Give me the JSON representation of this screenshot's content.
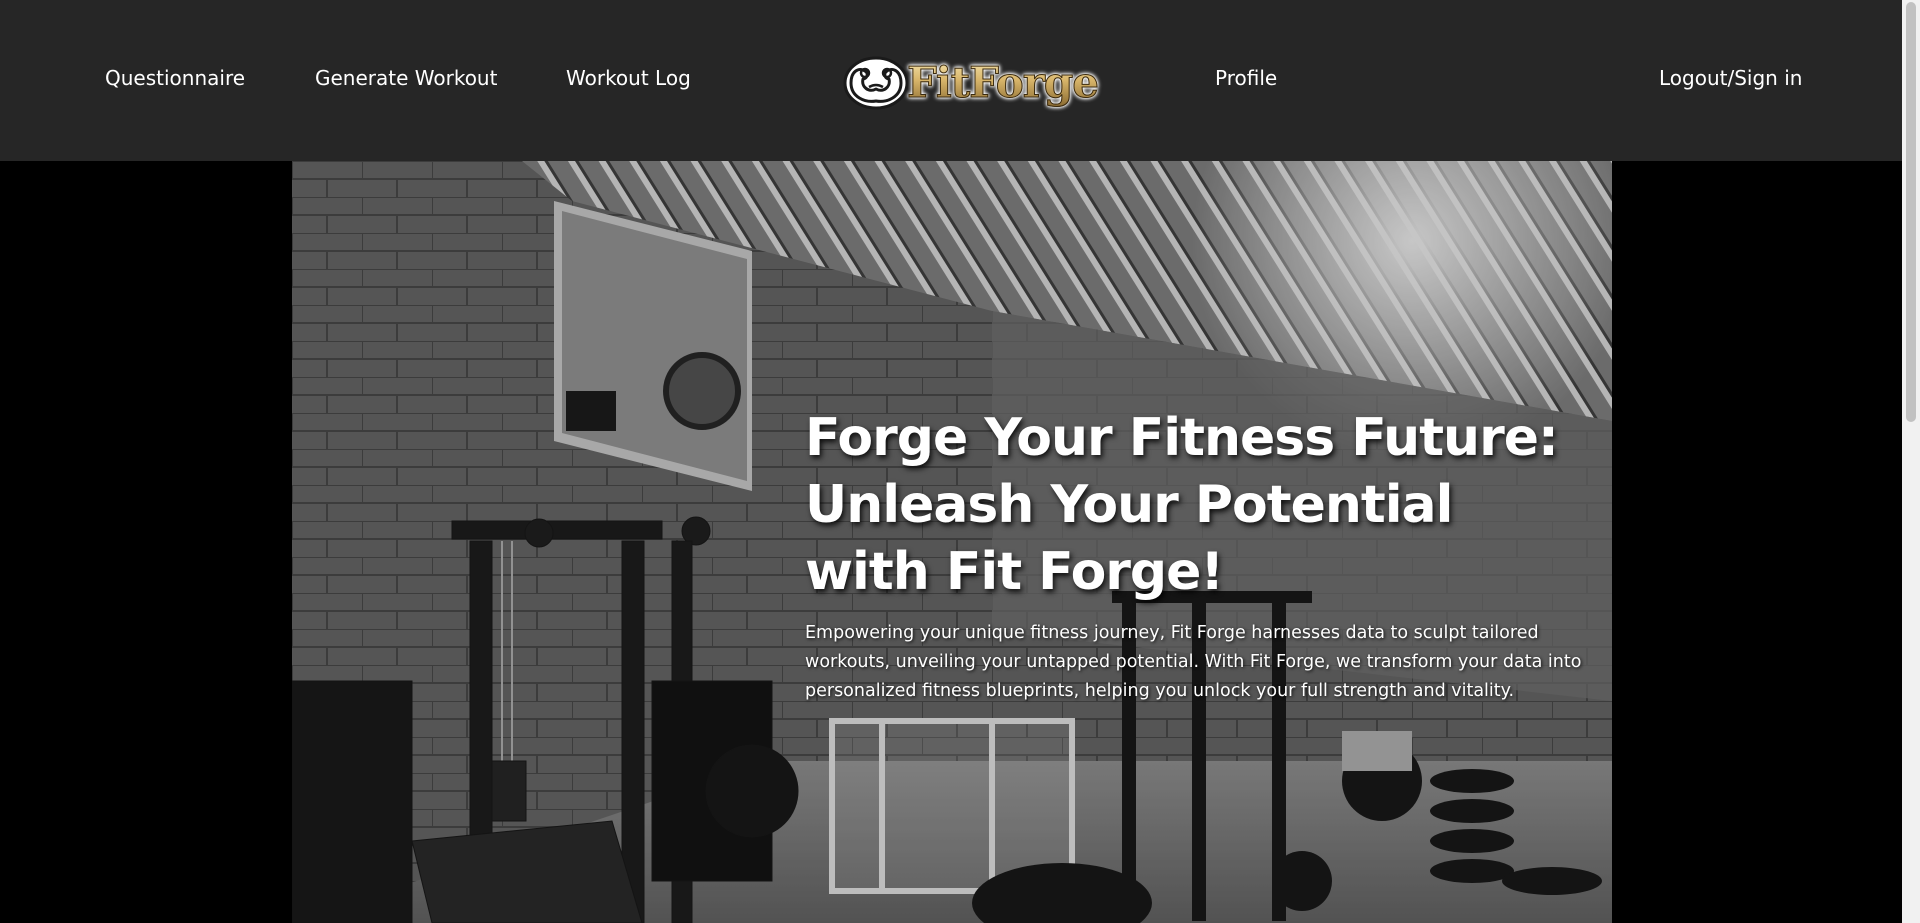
{
  "nav": {
    "questionnaire": "Questionnaire",
    "generate_workout": "Generate Workout",
    "workout_log": "Workout Log",
    "profile": "Profile",
    "logout_signin": "Logout/Sign in"
  },
  "logo": {
    "text": "FitForge",
    "icon": "flexing-arms-icon"
  },
  "hero": {
    "title": "Forge Your Fitness Future: Unleash Your Potential with Fit Forge!",
    "description": "Empowering your unique fitness journey, Fit Forge harnesses data to sculpt tailored workouts, unveiling your untapped potential. With Fit Forge, we transform your data into personalized fitness blueprints, helping you unlock your full strength and vitality."
  },
  "colors": {
    "navbar_bg": "#262626",
    "page_bg": "#000000",
    "text": "#ffffff",
    "logo_gold": "#d8b56a"
  }
}
